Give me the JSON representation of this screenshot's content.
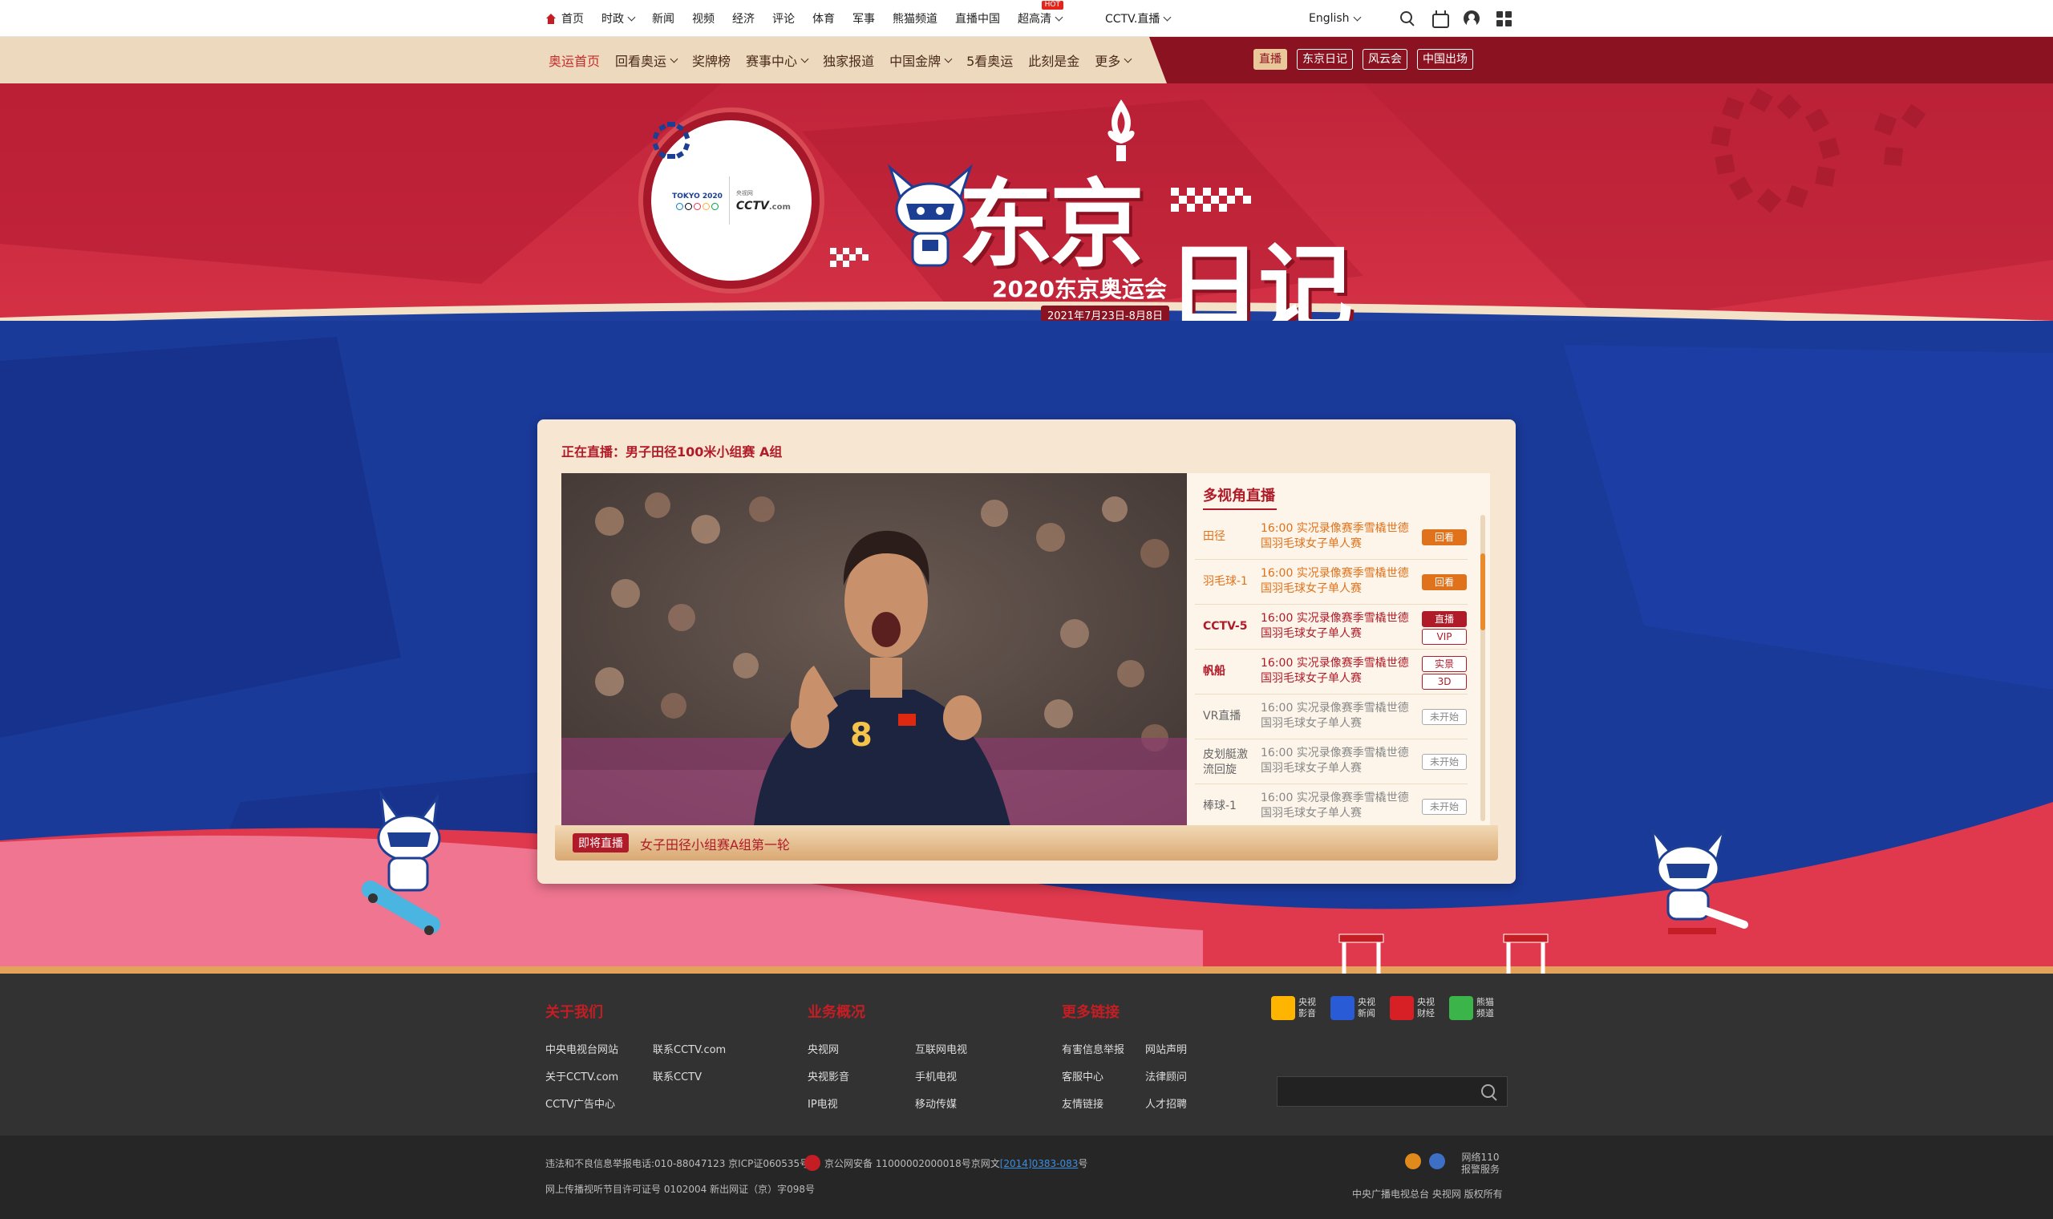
{
  "topnav": {
    "items": [
      {
        "label": "首页",
        "home": true
      },
      {
        "label": "时政",
        "caret": true
      },
      {
        "label": "新闻"
      },
      {
        "label": "视频"
      },
      {
        "label": "经济"
      },
      {
        "label": "评论"
      },
      {
        "label": "体育"
      },
      {
        "label": "军事"
      },
      {
        "label": "熊猫频道"
      },
      {
        "label": "直播中国"
      },
      {
        "label": "超高清",
        "caret": true,
        "badge": "HOT"
      },
      {
        "label": "CCTV.直播",
        "caret": true
      }
    ],
    "language": "English",
    "icons": [
      "search-icon",
      "tv-icon",
      "user-icon",
      "apps-grid-icon"
    ]
  },
  "subnav": {
    "items": [
      {
        "label": "奥运首页",
        "active": true
      },
      {
        "label": "回看奥运",
        "caret": true
      },
      {
        "label": "奖牌榜"
      },
      {
        "label": "赛事中心",
        "caret": true
      },
      {
        "label": "独家报道"
      },
      {
        "label": "中国金牌",
        "caret": true
      },
      {
        "label": "5看奥运"
      },
      {
        "label": "此刻是金"
      },
      {
        "label": "更多",
        "caret": true
      }
    ],
    "buttons": [
      "直播",
      "东京日记",
      "风云会",
      "中国出场"
    ]
  },
  "banner": {
    "title_line1": "东京",
    "title_line2": "日记",
    "subtitle": "2020东京奥运会",
    "date": "2021年7月23日-8月8日",
    "logo_tokyo": "TOKYO 2020",
    "logo_cctv": "CCTV",
    "logo_cctv_suffix": ".com",
    "logo_cctv_cn": "央视网"
  },
  "player": {
    "now_playing": "正在直播：男子田径100米小组赛 A组",
    "upcoming_tag": "即将直播",
    "upcoming_text": "女子田径小组赛A组第一轮",
    "multi_title": "多视角直播",
    "rows": [
      {
        "label": "田径",
        "time": "16:00",
        "info": "实况录像赛季雪橇世德国羽毛球女子单人赛",
        "status": [
          "回看"
        ],
        "style": "orange"
      },
      {
        "label": "羽毛球-1",
        "time": "16:00",
        "info": "实况录像赛季雪橇世德国羽毛球女子单人赛",
        "status": [
          "回看"
        ],
        "style": "orange"
      },
      {
        "label": "CCTV-5",
        "time": "16:00",
        "info": "实况录像赛季雪橇世德国羽毛球女子单人赛",
        "status": [
          "直播",
          "VIP"
        ],
        "style": "red"
      },
      {
        "label": "帆船",
        "time": "16:00",
        "info": "实况录像赛季雪橇世德国羽毛球女子单人赛",
        "status": [
          "实景",
          "3D"
        ],
        "style": "red"
      },
      {
        "label": "VR直播",
        "time": "16:00",
        "info": "实况录像赛季雪橇世德国羽毛球女子单人赛",
        "status": [
          "未开始"
        ],
        "style": "gray"
      },
      {
        "label": "皮划艇激流回旋",
        "time": "16:00",
        "info": "实况录像赛季雪橇世德国羽毛球女子单人赛",
        "status": [
          "未开始"
        ],
        "style": "gray"
      },
      {
        "label": "棒球-1",
        "time": "16:00",
        "info": "实况录像赛季雪橇世德国羽毛球女子单人赛",
        "status": [
          "未开始"
        ],
        "style": "gray"
      }
    ]
  },
  "footer": {
    "col1": {
      "title": "关于我们",
      "links": [
        "中央电视台网站",
        "联系CCTV.com",
        "关于CCTV.com",
        "联系CCTV",
        "CCTV广告中心"
      ]
    },
    "col2": {
      "title": "业务概况",
      "links": [
        "央视网",
        "互联网电视",
        "央视影音",
        "手机电视",
        "IP电视",
        "移动传媒"
      ]
    },
    "col3": {
      "title": "更多链接",
      "links": [
        "有害信息举报",
        "网站声明",
        "客服中心",
        "法律顾问",
        "友情链接",
        "人才招聘"
      ]
    },
    "apps": [
      {
        "name": "央视影音",
        "color": "#ffb400"
      },
      {
        "name": "央视新闻",
        "color": "#2a5bd7"
      },
      {
        "name": "央视财经",
        "color": "#d71f26"
      },
      {
        "name": "熊猫频道",
        "color": "#3bb54a"
      }
    ],
    "apps_names": [
      [
        "央视",
        "影音"
      ],
      [
        "央视",
        "新闻"
      ],
      [
        "央视",
        "财经"
      ],
      [
        "熊猫",
        "频道"
      ]
    ],
    "legal1": "违法和不良信息举报电话:010-88047123 京ICP证060535号",
    "legal2_pre": "京公网安备 11000002000018号京网文",
    "legal2_link": "[2014]0383-083",
    "legal2_post": "号",
    "legal3": "网上传播视听节目许可证号 0102004 新出网证（京）字098号",
    "report_line1": "网络110",
    "report_line2": "报警服务",
    "copyright": "中央广播电视总台 央视网 版权所有"
  },
  "colors": {
    "brand_red": "#b01b29",
    "dark_red": "#8b1221",
    "blue": "#1a3a9a",
    "beige": "#edd9bd",
    "orange": "#e0721c"
  }
}
